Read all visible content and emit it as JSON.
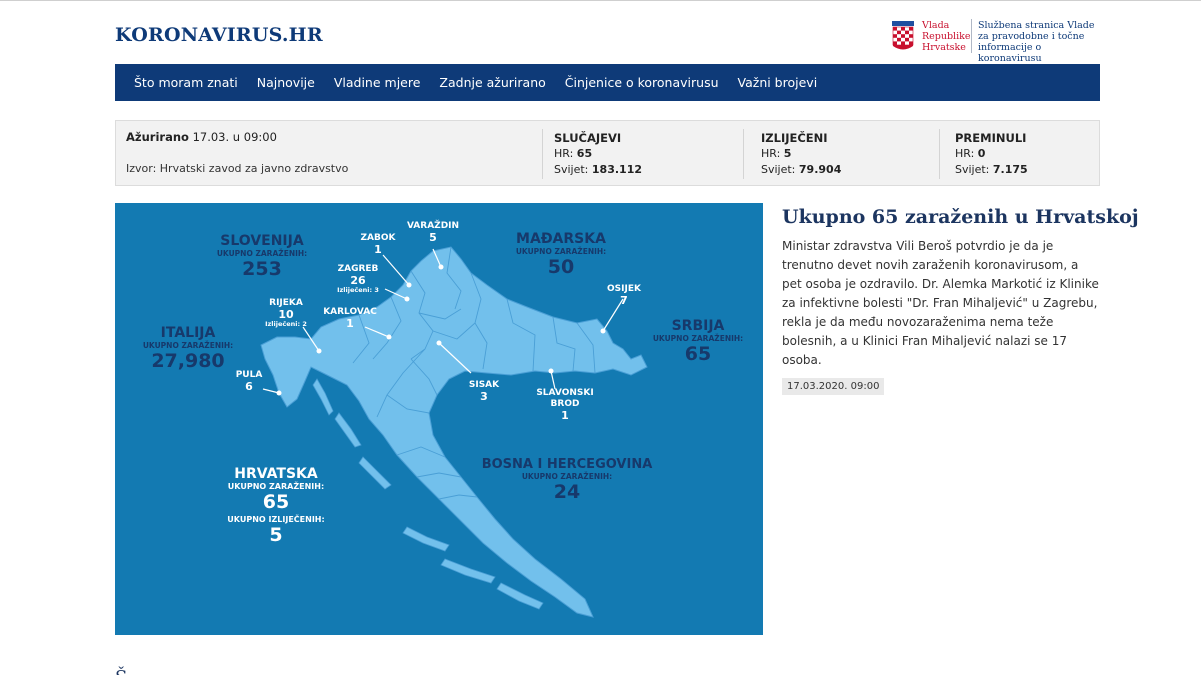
{
  "site": {
    "logo": "KORONAVIRUS.HR"
  },
  "gov": {
    "name_lines": [
      "Vlada",
      "Republike",
      "Hrvatske"
    ],
    "desc_lines": [
      "Službena stranica Vlade",
      "za pravodobne i točne",
      "informacije o  koronavirusu"
    ],
    "colors": {
      "red": "#c8102e",
      "blue": "#0e3a78"
    }
  },
  "nav": {
    "items": [
      "Što moram znati",
      "Najnovije",
      "Vladine mjere",
      "Zadnje ažurirano",
      "Činjenice o koronavirusu",
      "Važni brojevi"
    ]
  },
  "stats": {
    "updated_label": "Ažurirano",
    "updated_value": "17.03. u 09:00",
    "source": "Izvor: Hrvatski zavod za javno zdravstvo",
    "columns": [
      {
        "title": "SLUČAJEVI",
        "hr_label": "HR:",
        "hr_value": "65",
        "world_label": "Svijet:",
        "world_value": "183.112"
      },
      {
        "title": "IZLIJEČENI",
        "hr_label": "HR:",
        "hr_value": "5",
        "world_label": "Svijet:",
        "world_value": "79.904"
      },
      {
        "title": "PREMINULI",
        "hr_label": "HR:",
        "hr_value": "0",
        "world_label": "Svijet:",
        "world_value": "7.175"
      }
    ]
  },
  "map": {
    "colors": {
      "sea": "#137ab2",
      "land": "#72c0ec",
      "border": "#4a9fd6",
      "text_dark": "#17396b"
    },
    "countries": {
      "slovenija": {
        "name": "SLOVENIJA",
        "sub": "UKUPNO ZARAŽENIH:",
        "value": "253"
      },
      "madjarska": {
        "name": "MAĐARSKA",
        "sub": "UKUPNO ZARAŽENIH:",
        "value": "50"
      },
      "italija": {
        "name": "ITALIJA",
        "sub": "UKUPNO ZARAŽENIH:",
        "value": "27,980"
      },
      "srbija": {
        "name": "SRBIJA",
        "sub": "UKUPNO ZARAŽENIH:",
        "value": "65"
      },
      "bih": {
        "name": "BOSNA I HERCEGOVINA",
        "sub": "UKUPNO ZARAŽENIH:",
        "value": "24"
      }
    },
    "hrvatska": {
      "name": "HRVATSKA",
      "sub": "UKUPNO ZARAŽENIH:",
      "value": "65",
      "sub2": "UKUPNO IZLIJEČENIH:",
      "value2": "5"
    },
    "cities": {
      "zabok": {
        "name": "ZABOK",
        "value": "1"
      },
      "varazdin": {
        "name": "VARAŽDIN",
        "value": "5"
      },
      "zagreb": {
        "name": "ZAGREB",
        "value": "26",
        "note": "Izliječeni: 3"
      },
      "rijeka": {
        "name": "RIJEKA",
        "value": "10",
        "note": "Izliječeni: 2"
      },
      "karlovac": {
        "name": "KARLOVAC",
        "value": "1"
      },
      "osijek": {
        "name": "OSIJEK",
        "value": "7"
      },
      "pula": {
        "name": "PULA",
        "value": "6"
      },
      "sisak": {
        "name": "SISAK",
        "value": "3"
      },
      "slavonski_brod": {
        "name_lines": [
          "SLAVONSKI",
          "BROD"
        ],
        "value": "1"
      }
    }
  },
  "article": {
    "title": "Ukupno 65 zaraženih u Hrvatskoj",
    "body": "Ministar zdravstva Vili Beroš potvrdio je da je trenutno devet novih zaraženih koronavirusom, a pet osoba je ozdravilo. Dr. Alemka Markotić iz Klinike za infektivne bolesti \"Dr. Fran Mihaljević\" u Zagrebu, rekla je da među novozaraženima nema teže bolesnih, a u Klinici Fran Mihaljević nalazi se 17 osoba.",
    "date": "17.03.2020. 09:00"
  },
  "bottom": {
    "partial_heading": "Š"
  }
}
